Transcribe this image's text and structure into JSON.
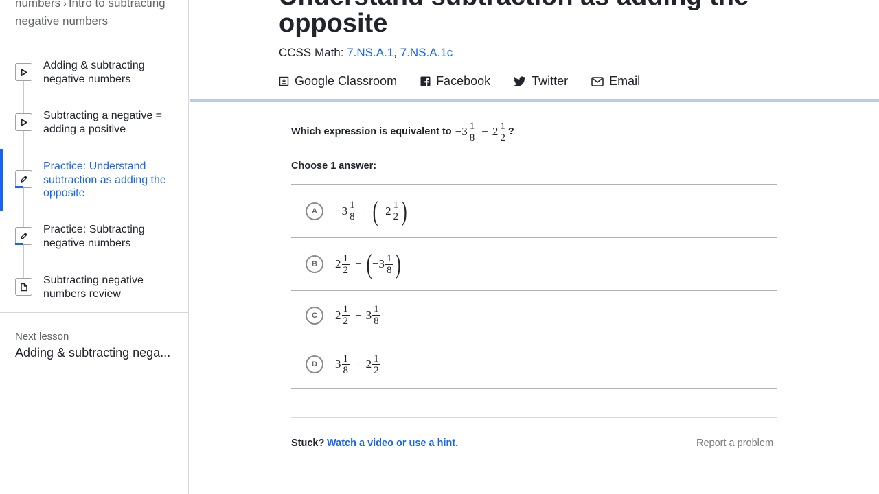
{
  "breadcrumb": {
    "parent": "numbers",
    "separator": "›",
    "current": "Intro to subtracting negative numbers"
  },
  "sidebar": {
    "items": [
      {
        "label": "Adding & subtracting negative numbers",
        "type": "video",
        "icon": "play-icon"
      },
      {
        "label": "Subtracting a negative = adding a positive",
        "type": "video",
        "icon": "play-icon"
      },
      {
        "label": "Practice: Understand subtraction as adding the opposite",
        "type": "practice",
        "icon": "pencil-icon",
        "active": true
      },
      {
        "label": "Practice: Subtracting negative numbers",
        "type": "practice",
        "icon": "pencil-icon"
      },
      {
        "label": "Subtracting negative numbers review",
        "type": "article",
        "icon": "article-icon"
      }
    ],
    "next_lesson_label": "Next lesson",
    "next_lesson_title": "Adding & subtracting nega..."
  },
  "header": {
    "title_line1": "Understand subtraction as adding the",
    "title_line2": "opposite",
    "ccss_label": "CCSS Math:",
    "ccss_links": [
      "7.NS.A.1",
      "7.NS.A.1c"
    ],
    "ccss_sep": ",",
    "share": {
      "google": "Google Classroom",
      "facebook": "Facebook",
      "twitter": "Twitter",
      "email": "Email"
    }
  },
  "question": {
    "prompt": "Which expression is equivalent to",
    "end": "?",
    "choose_label": "Choose 1 answer:",
    "choices": [
      {
        "letter": "A"
      },
      {
        "letter": "B"
      },
      {
        "letter": "C"
      },
      {
        "letter": "D"
      }
    ]
  },
  "math": {
    "minus": "−",
    "plus": "+",
    "lparen": "(",
    "rparen": ")",
    "w2": "2",
    "w3": "3",
    "n1": "1",
    "d2": "2",
    "d8": "8"
  },
  "footer": {
    "stuck": "Stuck?",
    "hint_link": "Watch a video or use a hint.",
    "report": "Report a problem"
  },
  "colors": {
    "accent": "#1865f2",
    "text": "#21242c",
    "muted": "#626569",
    "border": "#b1b3b6"
  }
}
